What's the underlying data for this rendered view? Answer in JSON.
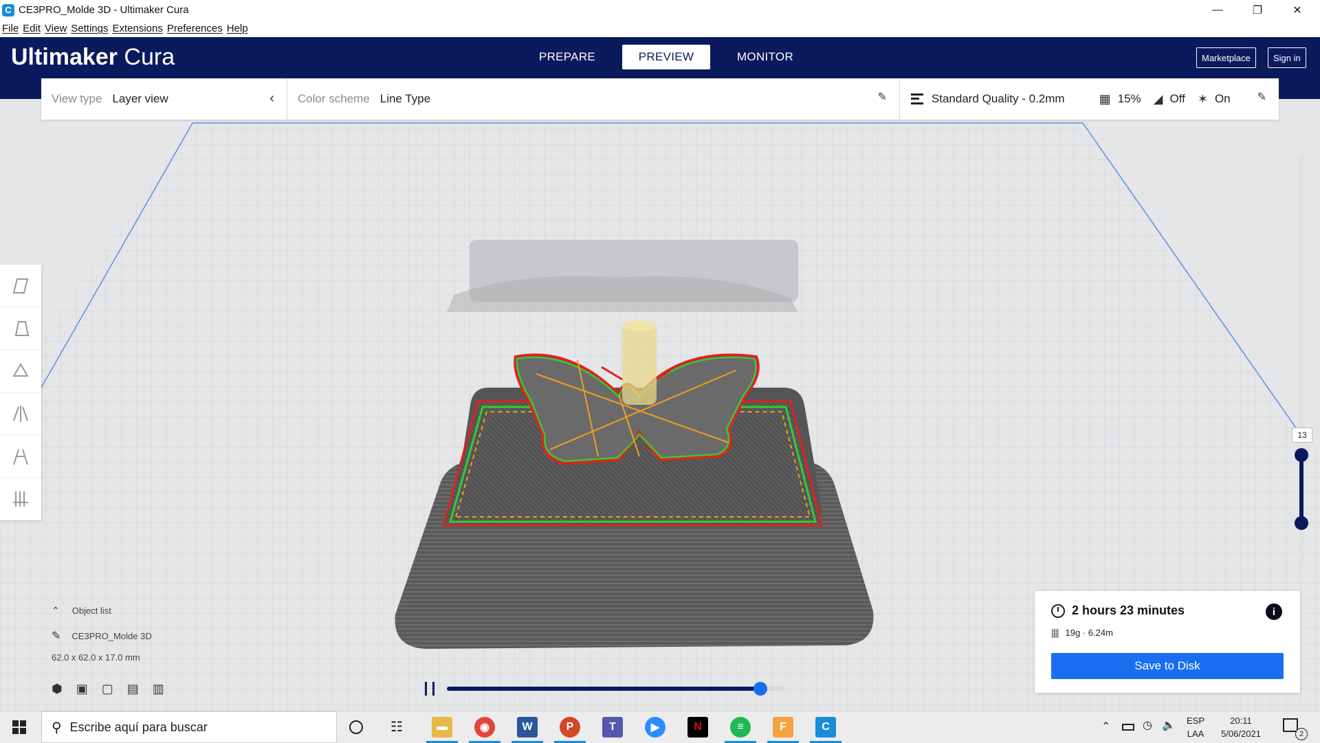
{
  "window": {
    "title": "CE3PRO_Molde 3D - Ultimaker Cura",
    "app_icon": "cura-icon",
    "controls": [
      "minimize-icon",
      "restore-icon",
      "close-icon"
    ]
  },
  "menu": [
    "File",
    "Edit",
    "View",
    "Settings",
    "Extensions",
    "Preferences",
    "Help"
  ],
  "header": {
    "logo_bold": "Ultimaker",
    "logo_light": "Cura",
    "stages": [
      "PREPARE",
      "PREVIEW",
      "MONITOR"
    ],
    "active_stage": "PREVIEW",
    "marketplace_label": "Marketplace",
    "signin_label": "Sign in",
    "background": "#0b1a5c"
  },
  "toolbar": {
    "view_type_label": "View type",
    "view_type_value": "Layer view",
    "color_scheme_label": "Color scheme",
    "color_scheme_value": "Line Type",
    "quality": "Standard Quality - 0.2mm",
    "infill": "15%",
    "support": "Off",
    "adhesion": "On"
  },
  "left_tools": [
    "move-icon",
    "scale-icon",
    "rotate-icon",
    "mirror-icon",
    "per-model-settings-icon",
    "support-blocker-icon"
  ],
  "object_list": {
    "header": "Object list",
    "object_name": "CE3PRO_Molde 3D",
    "dimensions": "62.0 x 62.0 x 17.0 mm",
    "camera_views": [
      "3d-view-icon",
      "front-view-icon",
      "top-view-icon",
      "left-view-icon",
      "right-view-icon"
    ]
  },
  "layer_slider": {
    "current_layer": "13",
    "max_fraction": 1.0
  },
  "path_scrubber": {
    "progress": 0.93
  },
  "print_info": {
    "time": "2 hours 23 minutes",
    "material": "19g · 6.24m",
    "save_label": "Save to Disk",
    "accent": "#196ef0"
  },
  "taskbar": {
    "search_placeholder": "Escribe aquí para buscar",
    "apps": [
      "file-explorer-icon",
      "chrome-icon",
      "word-icon",
      "powerpoint-icon",
      "teams-icon",
      "zoom-icon",
      "netflix-icon",
      "spotify-icon",
      "fusion-icon",
      "cura-icon"
    ],
    "lang_top": "ESP",
    "lang_bottom": "LAA",
    "time": "20:11",
    "date": "5/06/2021",
    "notifications": "2"
  }
}
